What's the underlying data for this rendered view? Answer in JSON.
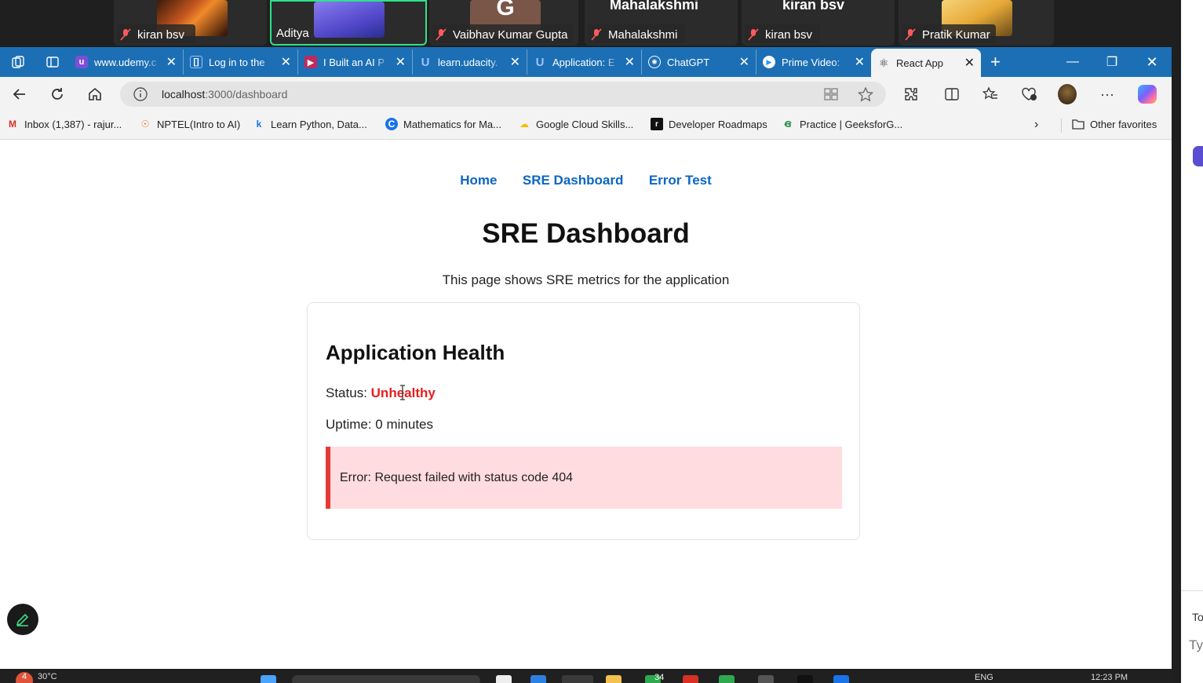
{
  "meeting": {
    "participants": [
      {
        "name": "kiran bsv"
      },
      {
        "name": "Aditya"
      },
      {
        "name": "Vaibhav Kumar Gupta"
      },
      {
        "name": "Mahalakshmi"
      },
      {
        "name": "kiran bsv"
      },
      {
        "name": "Pratik Kumar"
      }
    ],
    "top_labels": [
      "Mahalakshmi",
      "kiran bsv"
    ],
    "avatar_letter": "G"
  },
  "browser": {
    "tabs": [
      {
        "title": "www.udemy.c",
        "icon": "udemy-icon",
        "color": "#7b4fd6"
      },
      {
        "title": "Log in to the",
        "icon": "bracket-icon",
        "color": "#3a7bd5"
      },
      {
        "title": "I Built an AI P",
        "icon": "video-icon",
        "color": "#c02a5a"
      },
      {
        "title": "learn.udacity.",
        "icon": "udacity-icon",
        "color": "#2f7fe0"
      },
      {
        "title": "Application: E",
        "icon": "udacity-icon",
        "color": "#2f7fe0"
      },
      {
        "title": "ChatGPT",
        "icon": "chatgpt-icon",
        "color": "#ffffff"
      },
      {
        "title": "Prime Video:",
        "icon": "play-icon",
        "color": "#1a98ff"
      },
      {
        "title": "React App",
        "icon": "react-icon",
        "color": "#222222",
        "active": true
      }
    ],
    "url_host": "localhost",
    "url_path": ":3000/dashboard",
    "bookmarks": [
      {
        "label": "Inbox (1,387) - rajur...",
        "icon": "gmail-icon"
      },
      {
        "label": "NPTEL(Intro to AI)",
        "icon": "nptel-icon"
      },
      {
        "label": "Learn Python, Data...",
        "icon": "k-icon"
      },
      {
        "label": "Mathematics for Ma...",
        "icon": "coursera-icon"
      },
      {
        "label": "Google Cloud Skills...",
        "icon": "gcloud-icon"
      },
      {
        "label": "Developer Roadmaps",
        "icon": "roadmap-icon"
      },
      {
        "label": "Practice | GeeksforG...",
        "icon": "gfg-icon"
      }
    ],
    "other_favorites": "Other favorites"
  },
  "page": {
    "nav": [
      "Home",
      "SRE Dashboard",
      "Error Test"
    ],
    "title": "SRE Dashboard",
    "subtitle": "This page shows SRE metrics for the application",
    "card": {
      "heading": "Application Health",
      "status_label": "Status:",
      "status_value": "Unhealthy",
      "uptime": "Uptime: 0 minutes",
      "error": "Error: Request failed with status code 404"
    },
    "status_color": "#e61e1e"
  },
  "side_panel": {
    "text1": "To",
    "text2": "Ty"
  },
  "taskbar": {
    "weather": "30°C",
    "badge": "4",
    "lang": "ENG",
    "time": "12:23 PM",
    "app_badge": "34"
  }
}
